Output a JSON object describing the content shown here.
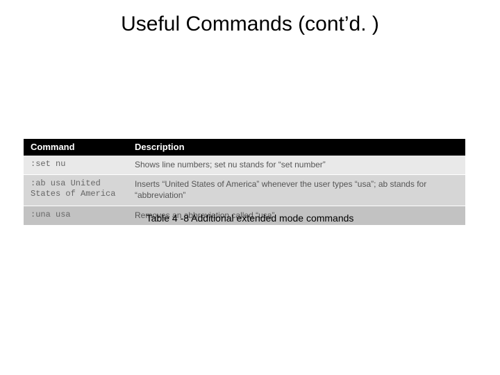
{
  "title": "Useful Commands (cont’d. )",
  "table": {
    "headers": {
      "command": "Command",
      "description": "Description"
    },
    "rows": [
      {
        "command": ":set nu",
        "description": "Shows line numbers; set nu stands for “set number”"
      },
      {
        "command": ":ab usa United\nStates of America",
        "description": "Inserts “United States of America” whenever the user types “usa”; ab stands for “abbreviation”"
      },
      {
        "command": ":una usa",
        "description": "Removes an abbreviation called “usa”"
      }
    ]
  },
  "caption": "Table 4 -8 Additional extended mode commands"
}
